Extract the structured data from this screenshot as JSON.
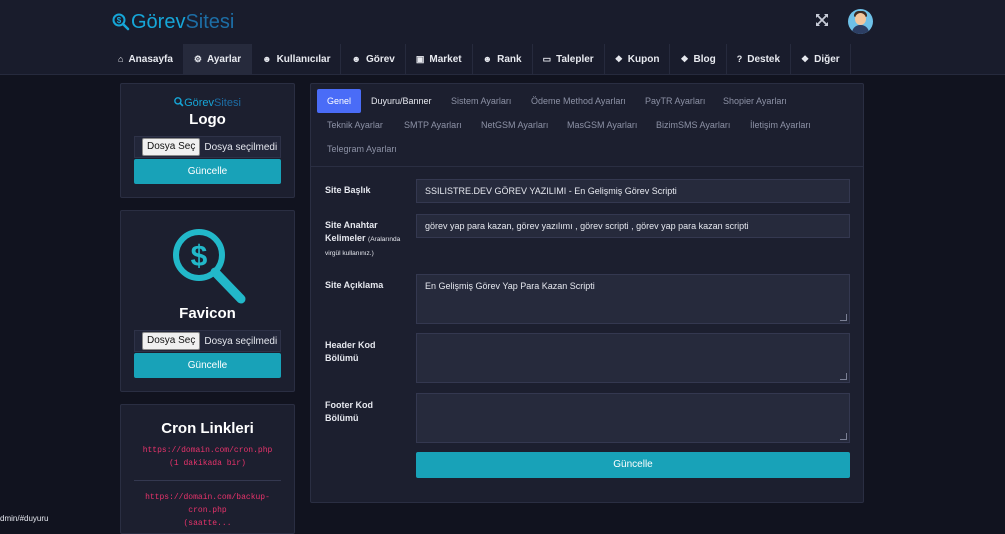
{
  "brand": {
    "part1": "Görev",
    "part2": "Sitesi"
  },
  "header": {
    "expand_icon": "expand-icon",
    "avatar_icon": "user-avatar"
  },
  "nav": {
    "items": [
      {
        "label": "Anasayfa",
        "icon": "home-icon",
        "glyph": "⌂"
      },
      {
        "label": "Ayarlar",
        "icon": "gears-icon",
        "glyph": "⚙"
      },
      {
        "label": "Kullanıcılar",
        "icon": "users-icon",
        "glyph": "☻"
      },
      {
        "label": "Görev",
        "icon": "users-icon",
        "glyph": "☻"
      },
      {
        "label": "Market",
        "icon": "briefcase-icon",
        "glyph": "▣"
      },
      {
        "label": "Rank",
        "icon": "users-icon",
        "glyph": "☻"
      },
      {
        "label": "Talepler",
        "icon": "ticket-icon",
        "glyph": "▭"
      },
      {
        "label": "Kupon",
        "icon": "gift-icon",
        "glyph": "❖"
      },
      {
        "label": "Blog",
        "icon": "gift-icon",
        "glyph": "❖"
      },
      {
        "label": "Destek",
        "icon": "question-icon",
        "glyph": "?"
      },
      {
        "label": "Diğer",
        "icon": "gift-icon",
        "glyph": "❖"
      }
    ],
    "active": "Ayarlar"
  },
  "logo_card": {
    "brand_part1": "Görev",
    "brand_part2": "Sitesi",
    "title": "Logo",
    "file_button": "Dosya Seç",
    "file_status": "Dosya seçilmedi",
    "submit": "Güncelle"
  },
  "favicon_card": {
    "title": "Favicon",
    "icon": "dollar-magnifier-icon",
    "file_button": "Dosya Seç",
    "file_status": "Dosya seçilmedi",
    "submit": "Güncelle"
  },
  "cron_card": {
    "title": "Cron Linkleri",
    "link1": "https://domain.com/cron.php",
    "link1_note": "(1 dakikada bir)",
    "link2_a": "https://domain.com/backup-",
    "link2_b": "cron.php",
    "link2_note": "(saatte..."
  },
  "tabs": {
    "row1": [
      "Genel",
      "Duyuru/Banner",
      "Sistem Ayarları",
      "Ödeme Method Ayarları",
      "PayTR Ayarları",
      "Shopier Ayarları"
    ],
    "row2": [
      "Teknik Ayarlar",
      "SMTP Ayarları",
      "NetGSM Ayarları",
      "MasGSM Ayarları",
      "BizimSMS Ayarları",
      "İletişim Ayarları"
    ],
    "row3": [
      "Telegram Ayarları"
    ],
    "active": "Genel"
  },
  "form": {
    "site_title_label": "Site Başlık",
    "site_title_value": "SSILISTRE.DEV GÖREV YAZILIMI - En Gelişmiş Görev Scripti",
    "keywords_label_a": "Site Anahtar",
    "keywords_label_b": "Kelimeler",
    "keywords_hint_a": "(Aralarında",
    "keywords_hint_b": "virgül kullanınız.)",
    "keywords_value": "görev yap para kazan, görev yazılımı , görev scripti , görev yap para kazan scripti",
    "description_label": "Site Açıklama",
    "description_value": "En Gelişmiş Görev Yap Para Kazan Scripti",
    "header_code_label_a": "Header Kod",
    "header_code_label_b": "Bölümü",
    "header_code_value": "",
    "footer_code_label_a": "Footer Kod",
    "footer_code_label_b": "Bölümü",
    "footer_code_value": "",
    "submit": "Güncelle"
  },
  "status_url": "dmin/#duyuru",
  "colors": {
    "accent_teal": "#18a2b8",
    "accent_blue": "#4a6cf7",
    "brand_cyan": "#16a6d8",
    "cron_pink": "#e7336b"
  }
}
